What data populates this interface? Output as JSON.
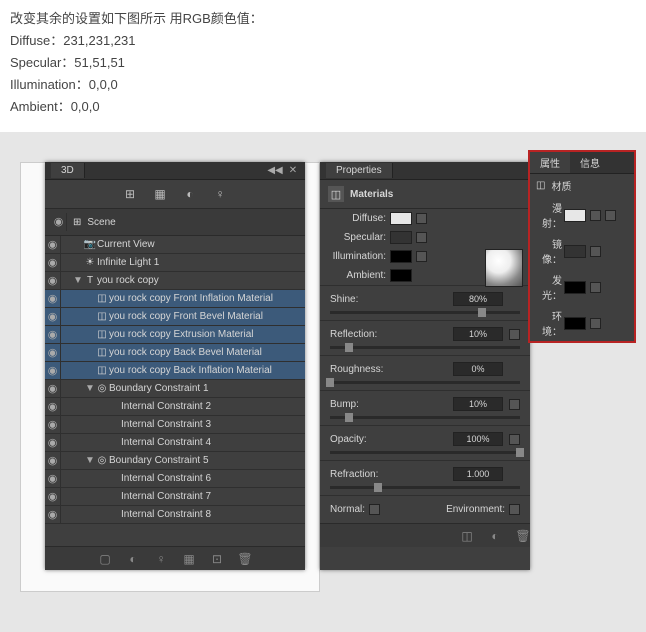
{
  "instructions": {
    "line1": "改变其余的设置如下图所示   用RGB颜色值：",
    "line2": "Diffuse：231,231,231",
    "line3": "Specular：51,51,51",
    "line4": "Illumination：0,0,0",
    "line5": "Ambient：0,0,0"
  },
  "panel3d": {
    "title": "3D",
    "scene_label": "Scene",
    "items": [
      {
        "label": "Current View",
        "indent": 1,
        "icon": "📷",
        "tw": ""
      },
      {
        "label": "Infinite Light 1",
        "indent": 1,
        "icon": "☀",
        "tw": ""
      },
      {
        "label": "you rock copy",
        "indent": 1,
        "icon": "T",
        "tw": "▼",
        "sel": false
      },
      {
        "label": "you rock copy Front Inflation Material",
        "indent": 2,
        "icon": "◫",
        "tw": "",
        "sel": true
      },
      {
        "label": "you rock copy Front Bevel Material",
        "indent": 2,
        "icon": "◫",
        "tw": "",
        "sel": true
      },
      {
        "label": "you rock copy Extrusion Material",
        "indent": 2,
        "icon": "◫",
        "tw": "",
        "sel": true
      },
      {
        "label": "you rock copy Back Bevel Material",
        "indent": 2,
        "icon": "◫",
        "tw": "",
        "sel": true
      },
      {
        "label": "you rock copy Back Inflation Material",
        "indent": 2,
        "icon": "◫",
        "tw": "",
        "sel": true
      },
      {
        "label": "Boundary Constraint 1",
        "indent": 2,
        "icon": "◎",
        "tw": "▼"
      },
      {
        "label": "Internal Constraint 2",
        "indent": 3,
        "icon": "",
        "tw": ""
      },
      {
        "label": "Internal Constraint 3",
        "indent": 3,
        "icon": "",
        "tw": ""
      },
      {
        "label": "Internal Constraint 4",
        "indent": 3,
        "icon": "",
        "tw": ""
      },
      {
        "label": "Boundary Constraint 5",
        "indent": 2,
        "icon": "◎",
        "tw": "▼"
      },
      {
        "label": "Internal Constraint 6",
        "indent": 3,
        "icon": "",
        "tw": ""
      },
      {
        "label": "Internal Constraint 7",
        "indent": 3,
        "icon": "",
        "tw": ""
      },
      {
        "label": "Internal Constraint 8",
        "indent": 3,
        "icon": "",
        "tw": ""
      }
    ]
  },
  "props": {
    "title": "Properties",
    "subtitle": "Materials",
    "swatches": [
      {
        "label": "Diffuse:",
        "color": "#e7e7e7",
        "folder": true
      },
      {
        "label": "Specular:",
        "color": "#333333",
        "folder": true
      },
      {
        "label": "Illumination:",
        "color": "#000000",
        "folder": true
      },
      {
        "label": "Ambient:",
        "color": "#000000",
        "folder": false
      }
    ],
    "sliders": [
      {
        "label": "Shine:",
        "val": "80%",
        "pos": 80,
        "folder": false
      },
      {
        "label": "Reflection:",
        "val": "10%",
        "pos": 10,
        "folder": true
      },
      {
        "label": "Roughness:",
        "val": "0%",
        "pos": 0,
        "folder": false
      },
      {
        "label": "Bump:",
        "val": "10%",
        "pos": 10,
        "folder": true
      },
      {
        "label": "Opacity:",
        "val": "100%",
        "pos": 100,
        "folder": true
      },
      {
        "label": "Refraction:",
        "val": "1.000",
        "pos": 25,
        "folder": false
      }
    ],
    "normal_label": "Normal:",
    "env_label": "Environment:"
  },
  "inset": {
    "tabs": [
      "属性",
      "信息"
    ],
    "subtitle": "材质",
    "rows": [
      {
        "label": "漫射：",
        "color": "#e7e7e7",
        "extra": true
      },
      {
        "label": "镜像：",
        "color": "#333333"
      },
      {
        "label": "发光：",
        "color": "#000000"
      },
      {
        "label": "环境：",
        "color": "#000000"
      }
    ]
  }
}
